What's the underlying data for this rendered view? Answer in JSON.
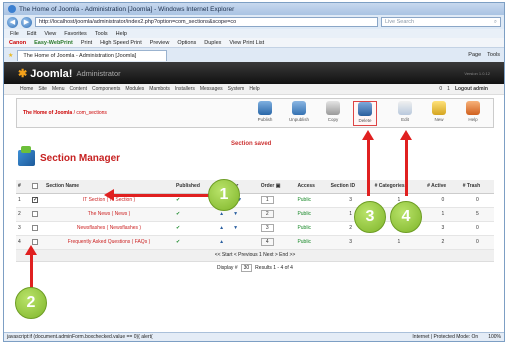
{
  "window": {
    "title": "The Home of Joomla - Administration [Joomla] - Windows Internet Explorer"
  },
  "address": {
    "url": "http://localhost/joomla/administrator/index2.php?option=com_sections&scope=co",
    "search_placeholder": "Live Search"
  },
  "menubar": [
    "File",
    "Edit",
    "View",
    "Favorites",
    "Tools",
    "Help"
  ],
  "printbar": {
    "canon": "Canon",
    "ewp": "Easy-WebPrint",
    "items": [
      "Print",
      "High Speed Print",
      "Preview",
      "Options",
      "Duplex",
      "View Print List"
    ]
  },
  "tab": {
    "title": "The Home of Joomla - Administration [Joomla]",
    "right": [
      "Page",
      "Tools"
    ]
  },
  "joomla": {
    "logo_word": "Joomla!",
    "logo_sub": "Administrator",
    "version": "Version 1.0.12"
  },
  "jmenu": {
    "items": [
      "Home",
      "Site",
      "Menu",
      "Content",
      "Components",
      "Modules",
      "Mambots",
      "Installers",
      "Messages",
      "System",
      "Help"
    ],
    "counts": [
      "0",
      "1"
    ],
    "logout": "Logout admin"
  },
  "breadcrumb": {
    "site": "The Home of Joomla",
    "path": "/ com_sections"
  },
  "toolbar": [
    "Publish",
    "Unpublish",
    "Copy",
    "Delete",
    "Edit",
    "New",
    "Help"
  ],
  "message": "Section saved",
  "manager_title": "Section Manager",
  "table": {
    "headers": [
      "#",
      "",
      "Section Name",
      "Published",
      "Reorder",
      "Order",
      "Access",
      "Section ID",
      "# Categories",
      "# Active",
      "# Trash"
    ],
    "rows": [
      {
        "n": "1",
        "checked": true,
        "name": "IT Section ( IT Section )",
        "order": "1",
        "access": "Public",
        "id": "3",
        "cats": "1",
        "active": "0",
        "trash": "0"
      },
      {
        "n": "2",
        "checked": false,
        "name": "The News ( News )",
        "order": "2",
        "access": "Public",
        "id": "1",
        "cats": "1",
        "active": "1",
        "trash": "5"
      },
      {
        "n": "3",
        "checked": false,
        "name": "Newsflashes ( Newsflashes )",
        "order": "3",
        "access": "Public",
        "id": "2",
        "cats": "1",
        "active": "3",
        "trash": "0"
      },
      {
        "n": "4",
        "checked": false,
        "name": "Frequently Asked Questions ( FAQs )",
        "order": "4",
        "access": "Public",
        "id": "3",
        "cats": "1",
        "active": "2",
        "trash": "0"
      }
    ]
  },
  "pager": "<< Start < Previous 1 Next > End >>",
  "display": {
    "label": "Display #",
    "value": "30",
    "results": "Results 1 - 4 of 4"
  },
  "status": {
    "left": "javascript:if (document.adminForm.boxchecked.value == 0){ alert(",
    "zone": "Internet | Protected Mode: On",
    "zoom": "100%"
  },
  "callouts": [
    "1",
    "2",
    "3",
    "4"
  ]
}
